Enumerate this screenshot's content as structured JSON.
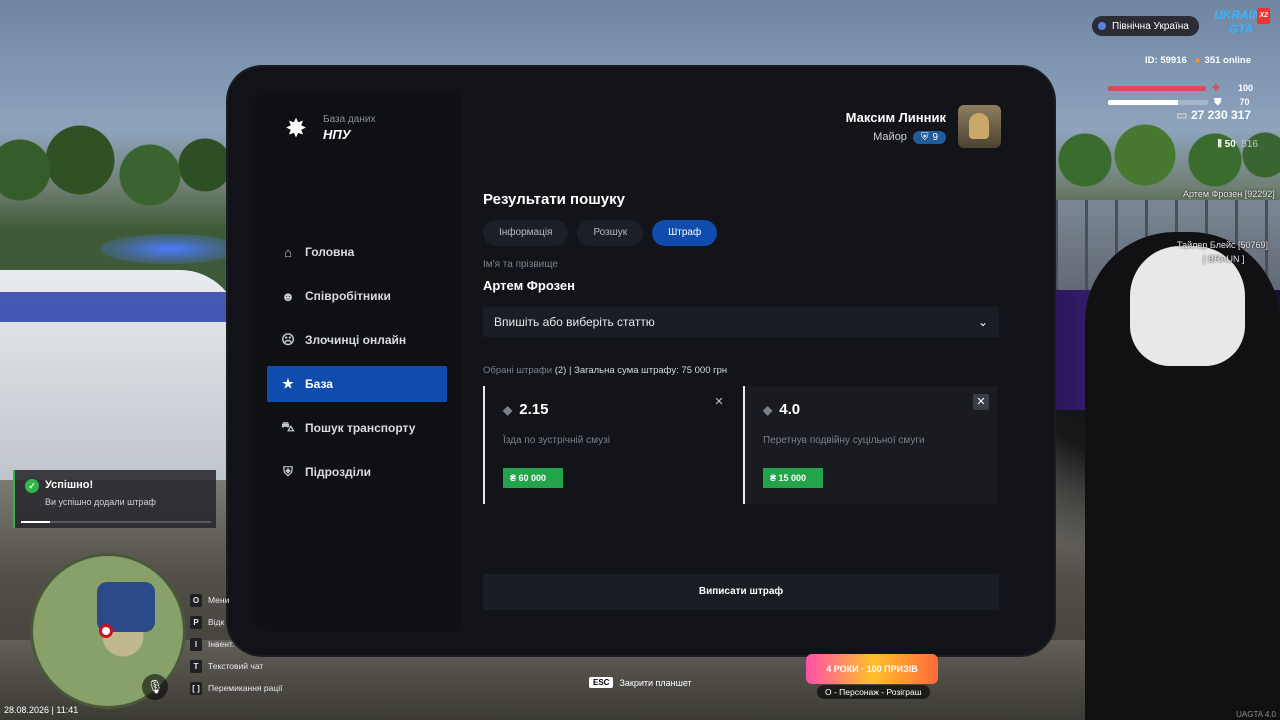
{
  "app": {
    "brand_subtitle": "База даних",
    "brand_title": "НПУ",
    "user_name": "Максим Линник",
    "user_rank": "Майор",
    "user_level": "9"
  },
  "sidebar": {
    "items": [
      {
        "label": "Головна",
        "icon": "home-icon"
      },
      {
        "label": "Співробітники",
        "icon": "staff-icon"
      },
      {
        "label": "Злочинці онлайн",
        "icon": "criminal-icon"
      },
      {
        "label": "База",
        "icon": "star-icon",
        "active": true
      },
      {
        "label": "Пошук транспорту",
        "icon": "car-icon"
      },
      {
        "label": "Підрозділи",
        "icon": "shield-icon"
      }
    ]
  },
  "main": {
    "title": "Результати пошуку",
    "tabs": [
      {
        "label": "Інформація"
      },
      {
        "label": "Розшук"
      },
      {
        "label": "Штраф",
        "active": true
      }
    ],
    "name_label": "Ім'я та прізвище",
    "name_value": "Артем Фрозен",
    "article_select_placeholder": "Впишіть або виберіть статтю",
    "summary_muted": "Обрані штрафи",
    "summary_count": "(2)",
    "summary_total": "| Загальна сума штрафу: 75 000 грн",
    "fines": [
      {
        "code": "2.15",
        "description": "Їзда по зустрічній смузі",
        "amount": "₴ 60 000"
      },
      {
        "code": "4.0",
        "description": "Перетнув подвійну суцільної смуги",
        "amount": "₴ 15 000"
      }
    ],
    "issue_button": "Виписати штраф"
  },
  "hud": {
    "region": "Північна Україна",
    "logo_text": "UKRAINE GTA",
    "logo_badge": "X2",
    "player_id": "ID: 59916",
    "online": "351 online",
    "health": 100,
    "armor": 70,
    "health_label": "100",
    "armor_label": "70",
    "money": "27 230 317",
    "ammo": "50",
    "ammo_total": "516",
    "colors": {
      "health": "#e0475a",
      "armor": "#ffffff",
      "accent": "#0f4cae",
      "success": "#23a34a"
    }
  },
  "world": {
    "player_tag_1": "Артем Фрозен [92292]",
    "player_tag_2": "Тайлер Блейс [50769]",
    "player_tag_2_sub": "[ BRAUN ]"
  },
  "notification": {
    "title": "Успішно!",
    "message": "Ви успішно додали штраф",
    "progress": 0.15
  },
  "keys": [
    {
      "key": "O",
      "label": "Мени"
    },
    {
      "key": "P",
      "label": "Відк"
    },
    {
      "key": "I",
      "label": "Інвент."
    },
    {
      "key": "T",
      "label": "Текстовий чат"
    },
    {
      "key": "[ ]",
      "label": "Перемикання рації"
    }
  ],
  "footer": {
    "datetime": "28.08.2026 | 11:41",
    "esc_key": "ESC",
    "esc_label": "Закрити планшет",
    "promo_text": "4 РОКИ · 100 ПРИЗІВ",
    "promo_label": "O - Персонаж - Розіграш",
    "version": "UAGTA 4.0"
  }
}
